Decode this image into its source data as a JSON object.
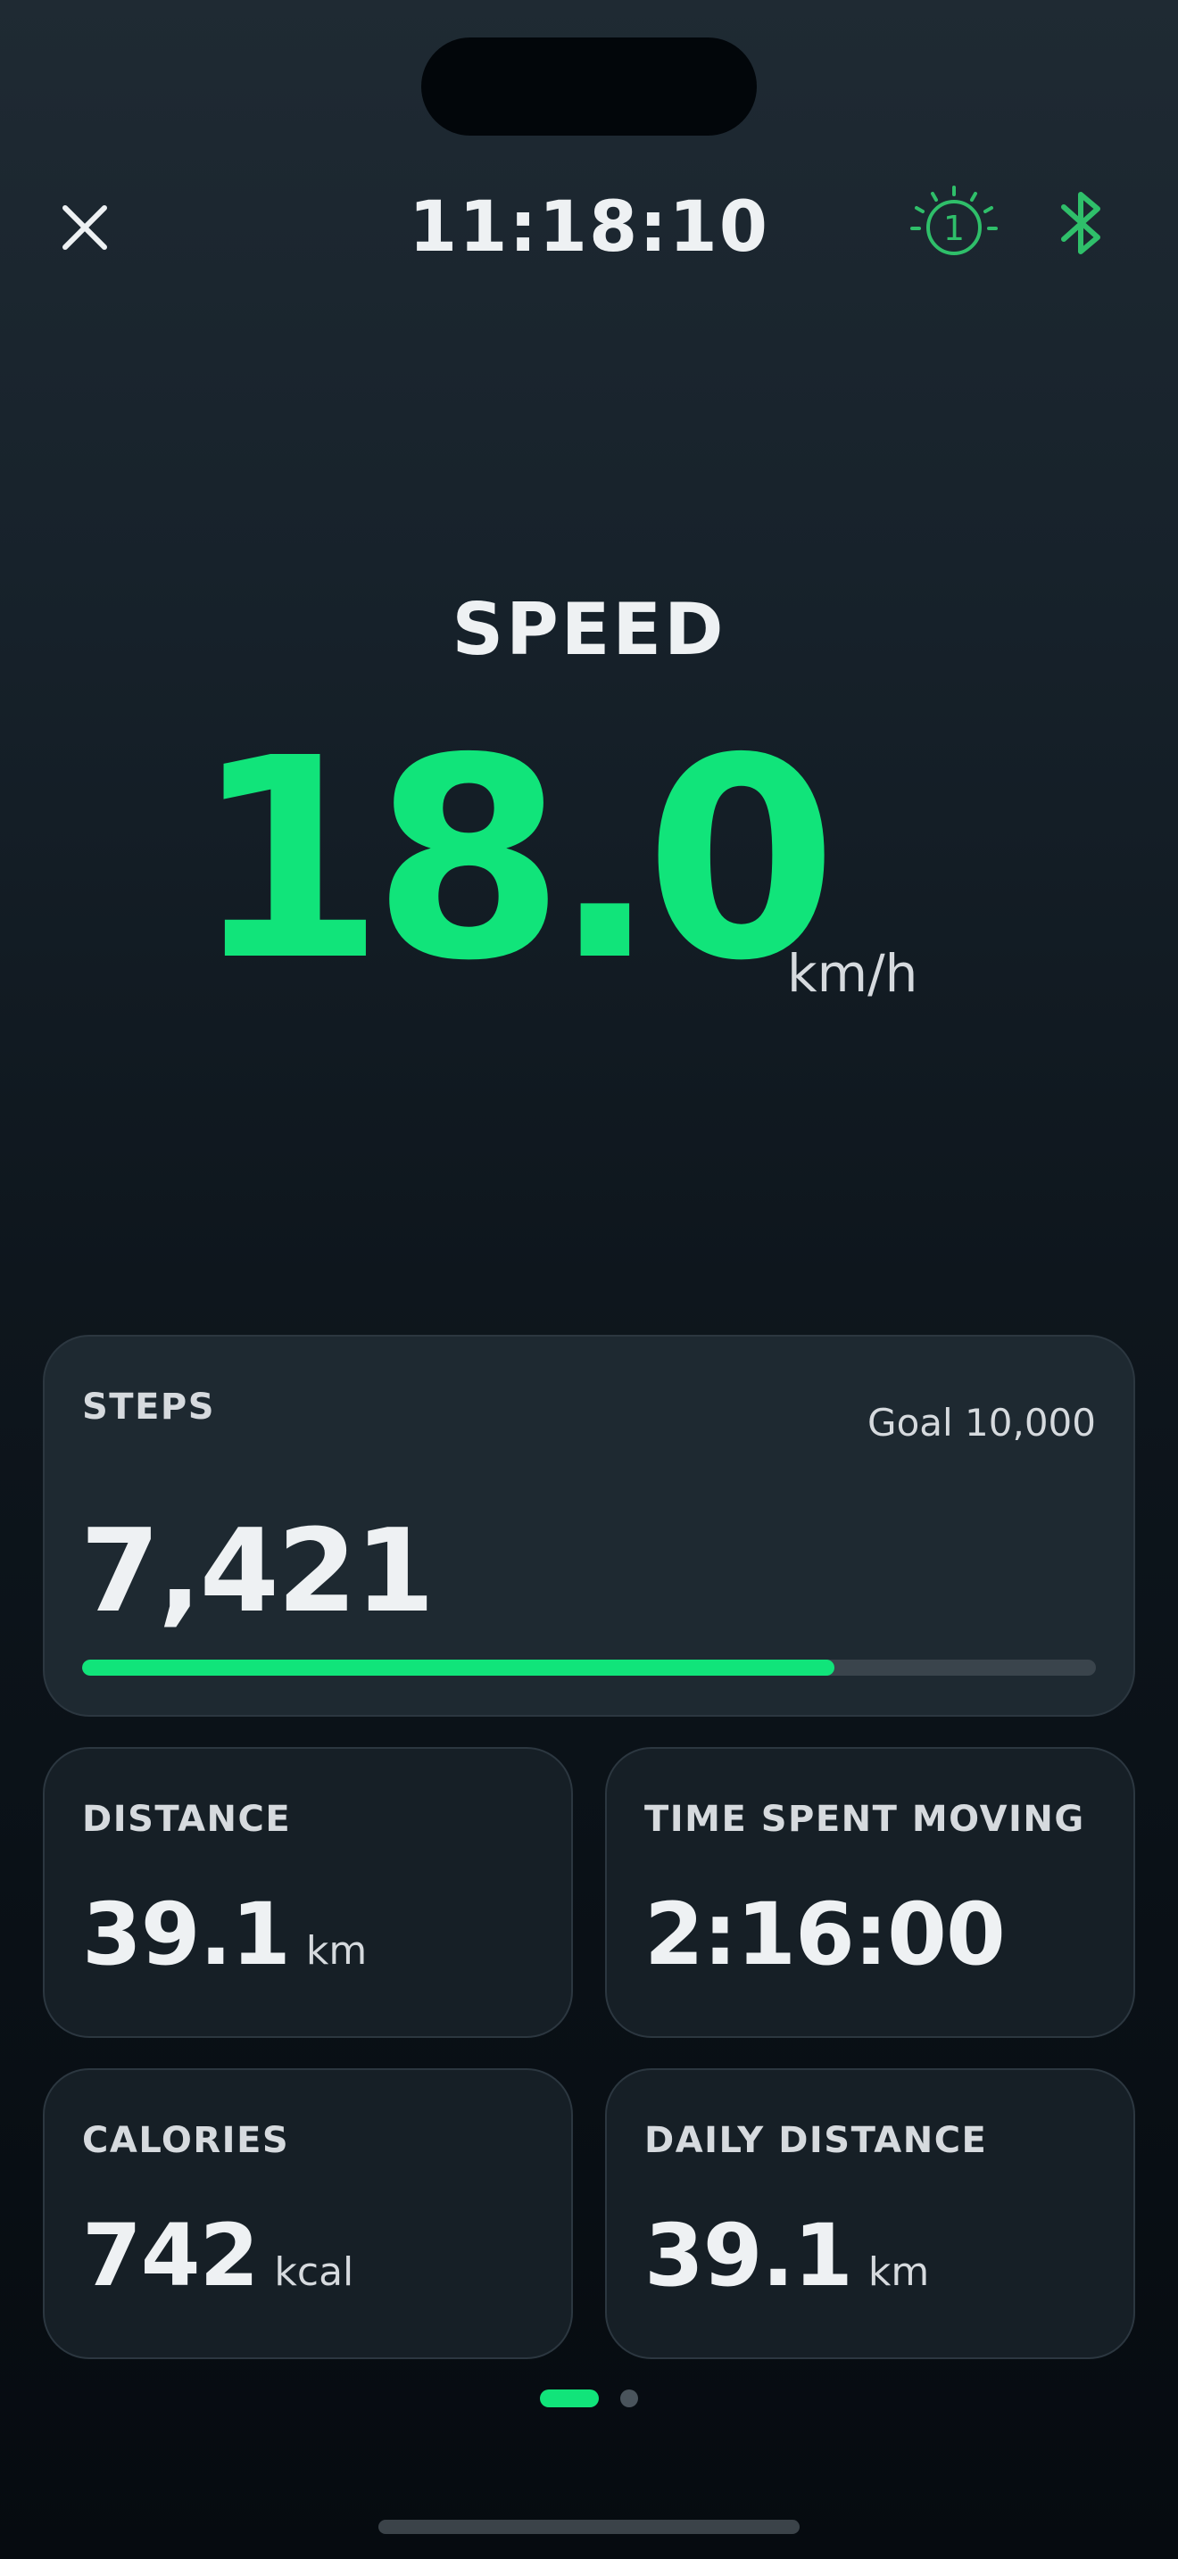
{
  "header": {
    "time": "11:18:10",
    "timer_badge": "1",
    "close_icon": "close-icon",
    "timer_icon": "timer-icon",
    "bluetooth_icon": "bluetooth-icon"
  },
  "speed": {
    "label": "SPEED",
    "value": "18.0",
    "unit": "km/h"
  },
  "steps": {
    "label": "STEPS",
    "goal": "Goal 10,000",
    "value": "7,421",
    "progress": 0.7421
  },
  "metrics": [
    {
      "label": "DISTANCE",
      "value": "39.1",
      "unit": "km"
    },
    {
      "label": "TIME SPENT MOVING",
      "value": "2:16:00",
      "unit": ""
    },
    {
      "label": "CALORIES",
      "value": "742",
      "unit": "kcal"
    },
    {
      "label": "DAILY DISTANCE",
      "value": "39.1",
      "unit": "km"
    }
  ],
  "pager": {
    "current": 1,
    "total": 2
  },
  "colors": {
    "accent": "#11e47a",
    "icon_green": "#2fbf6a",
    "background_top": "#1f2a33",
    "background_bottom": "#060b10",
    "card": "#1c262e",
    "text": "#eef1f3"
  }
}
